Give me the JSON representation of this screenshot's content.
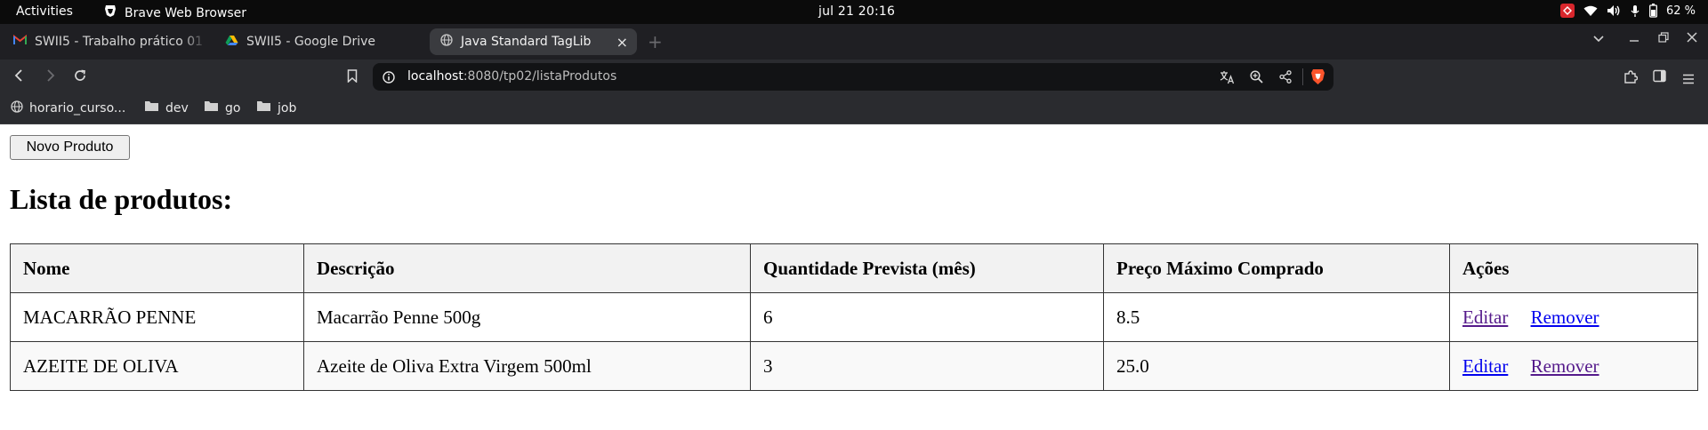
{
  "system": {
    "activities": "Activities",
    "app_name": "Brave Web Browser",
    "clock": "jul 21  20:16",
    "battery": "62 %"
  },
  "tabs": [
    {
      "label": "SWII5 - Trabalho prático 01 -",
      "icon": "gmail-icon",
      "active": false
    },
    {
      "label": "SWII5 - Google Drive",
      "icon": "google-drive-icon",
      "active": false
    },
    {
      "label": "Java Standard TagLib",
      "icon": "globe-icon",
      "active": true
    }
  ],
  "address_bar": {
    "host": "localhost",
    "path": ":8080/tp02/listaProdutos"
  },
  "bookmarks": [
    {
      "label": "horario_curso...",
      "icon": "globe-icon"
    },
    {
      "label": "dev",
      "icon": "folder-icon"
    },
    {
      "label": "go",
      "icon": "folder-icon"
    },
    {
      "label": "job",
      "icon": "folder-icon"
    }
  ],
  "page": {
    "new_button": "Novo Produto",
    "title": "Lista de produtos:",
    "table": {
      "headers": [
        "Nome",
        "Descrição",
        "Quantidade Prevista (mês)",
        "Preço Máximo Comprado",
        "Ações"
      ],
      "rows": [
        {
          "nome": "MACARRÃO PENNE",
          "descricao": "Macarrão Penne 500g",
          "quantidade": "6",
          "preco": "8.5",
          "edit": "Editar",
          "remove": "Remover"
        },
        {
          "nome": "AZEITE DE OLIVA",
          "descricao": "Azeite de Oliva Extra Virgem 500ml",
          "quantidade": "3",
          "preco": "25.0",
          "edit": "Editar",
          "remove": "Remover"
        }
      ]
    }
  },
  "colors": {
    "topbar": "#0b0b0b",
    "tabstrip": "#1f1f23",
    "toolbar": "#2a2b2f",
    "urlbar": "#121315",
    "link": "#0000ee",
    "visited_link": "#551a8b",
    "brave": "#fb542b"
  }
}
